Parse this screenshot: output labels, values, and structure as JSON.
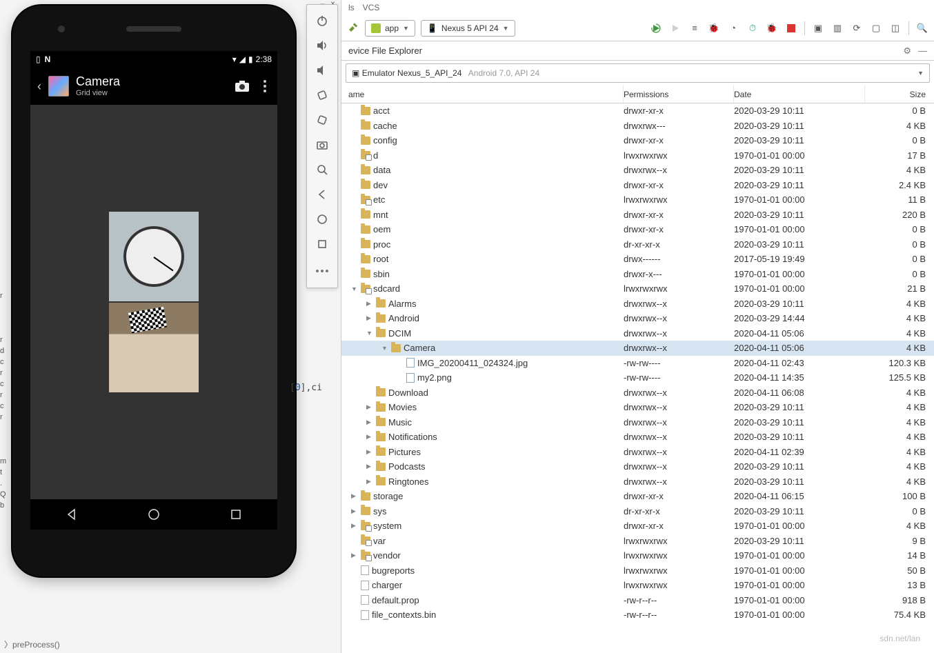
{
  "ide_menu_fragment": [
    "ls",
    "VCS"
  ],
  "emulator": {
    "status_time": "2:38",
    "app_title": "Camera",
    "app_subtitle": "Grid view"
  },
  "toolbar": {
    "run_config": "app",
    "device": "Nexus 5 API 24"
  },
  "panel": {
    "title": "evice File Explorer",
    "device_label": "Emulator Nexus_5_API_24",
    "device_sub": "Android 7.0, API 24"
  },
  "columns": {
    "name": "ame",
    "perm": "Permissions",
    "date": "Date",
    "size": "Size"
  },
  "tree": [
    {
      "d": 0,
      "t": "none",
      "ic": "folder",
      "n": "acct",
      "p": "drwxr-xr-x",
      "dt": "2020-03-29 10:11",
      "s": "0 B"
    },
    {
      "d": 0,
      "t": "none",
      "ic": "folder",
      "n": "cache",
      "p": "drwxrwx---",
      "dt": "2020-03-29 10:11",
      "s": "4 KB"
    },
    {
      "d": 0,
      "t": "none",
      "ic": "folder",
      "n": "config",
      "p": "drwxr-xr-x",
      "dt": "2020-03-29 10:11",
      "s": "0 B"
    },
    {
      "d": 0,
      "t": "none",
      "ic": "folderlink",
      "n": "d",
      "p": "lrwxrwxrwx",
      "dt": "1970-01-01 00:00",
      "s": "17 B"
    },
    {
      "d": 0,
      "t": "none",
      "ic": "folder",
      "n": "data",
      "p": "drwxrwx--x",
      "dt": "2020-03-29 10:11",
      "s": "4 KB"
    },
    {
      "d": 0,
      "t": "none",
      "ic": "folder",
      "n": "dev",
      "p": "drwxr-xr-x",
      "dt": "2020-03-29 10:11",
      "s": "2.4 KB"
    },
    {
      "d": 0,
      "t": "none",
      "ic": "folderlink",
      "n": "etc",
      "p": "lrwxrwxrwx",
      "dt": "1970-01-01 00:00",
      "s": "11 B"
    },
    {
      "d": 0,
      "t": "none",
      "ic": "folder",
      "n": "mnt",
      "p": "drwxr-xr-x",
      "dt": "2020-03-29 10:11",
      "s": "220 B"
    },
    {
      "d": 0,
      "t": "none",
      "ic": "folder",
      "n": "oem",
      "p": "drwxr-xr-x",
      "dt": "1970-01-01 00:00",
      "s": "0 B"
    },
    {
      "d": 0,
      "t": "none",
      "ic": "folder",
      "n": "proc",
      "p": "dr-xr-xr-x",
      "dt": "2020-03-29 10:11",
      "s": "0 B"
    },
    {
      "d": 0,
      "t": "none",
      "ic": "folder",
      "n": "root",
      "p": "drwx------",
      "dt": "2017-05-19 19:49",
      "s": "0 B"
    },
    {
      "d": 0,
      "t": "none",
      "ic": "folder",
      "n": "sbin",
      "p": "drwxr-x---",
      "dt": "1970-01-01 00:00",
      "s": "0 B"
    },
    {
      "d": 0,
      "t": "open",
      "ic": "folderlink",
      "n": "sdcard",
      "p": "lrwxrwxrwx",
      "dt": "1970-01-01 00:00",
      "s": "21 B"
    },
    {
      "d": 1,
      "t": "closed",
      "ic": "folder",
      "n": "Alarms",
      "p": "drwxrwx--x",
      "dt": "2020-03-29 10:11",
      "s": "4 KB"
    },
    {
      "d": 1,
      "t": "closed",
      "ic": "folder",
      "n": "Android",
      "p": "drwxrwx--x",
      "dt": "2020-03-29 14:44",
      "s": "4 KB"
    },
    {
      "d": 1,
      "t": "open",
      "ic": "folder",
      "n": "DCIM",
      "p": "drwxrwx--x",
      "dt": "2020-04-11 05:06",
      "s": "4 KB"
    },
    {
      "d": 2,
      "t": "open",
      "ic": "folder",
      "n": "Camera",
      "p": "drwxrwx--x",
      "dt": "2020-04-11 05:06",
      "s": "4 KB",
      "sel": true
    },
    {
      "d": 3,
      "t": "none",
      "ic": "file",
      "n": "IMG_20200411_024324.jpg",
      "p": "-rw-rw----",
      "dt": "2020-04-11 02:43",
      "s": "120.3 KB"
    },
    {
      "d": 3,
      "t": "none",
      "ic": "file",
      "n": "my2.png",
      "p": "-rw-rw----",
      "dt": "2020-04-11 14:35",
      "s": "125.5 KB"
    },
    {
      "d": 1,
      "t": "none",
      "ic": "folder",
      "n": "Download",
      "p": "drwxrwx--x",
      "dt": "2020-04-11 06:08",
      "s": "4 KB"
    },
    {
      "d": 1,
      "t": "closed",
      "ic": "folder",
      "n": "Movies",
      "p": "drwxrwx--x",
      "dt": "2020-03-29 10:11",
      "s": "4 KB"
    },
    {
      "d": 1,
      "t": "closed",
      "ic": "folder",
      "n": "Music",
      "p": "drwxrwx--x",
      "dt": "2020-03-29 10:11",
      "s": "4 KB"
    },
    {
      "d": 1,
      "t": "closed",
      "ic": "folder",
      "n": "Notifications",
      "p": "drwxrwx--x",
      "dt": "2020-03-29 10:11",
      "s": "4 KB"
    },
    {
      "d": 1,
      "t": "closed",
      "ic": "folder",
      "n": "Pictures",
      "p": "drwxrwx--x",
      "dt": "2020-04-11 02:39",
      "s": "4 KB"
    },
    {
      "d": 1,
      "t": "closed",
      "ic": "folder",
      "n": "Podcasts",
      "p": "drwxrwx--x",
      "dt": "2020-03-29 10:11",
      "s": "4 KB"
    },
    {
      "d": 1,
      "t": "closed",
      "ic": "folder",
      "n": "Ringtones",
      "p": "drwxrwx--x",
      "dt": "2020-03-29 10:11",
      "s": "4 KB"
    },
    {
      "d": 0,
      "t": "closed",
      "ic": "folder",
      "n": "storage",
      "p": "drwxr-xr-x",
      "dt": "2020-04-11 06:15",
      "s": "100 B"
    },
    {
      "d": 0,
      "t": "closed",
      "ic": "folder",
      "n": "sys",
      "p": "dr-xr-xr-x",
      "dt": "2020-03-29 10:11",
      "s": "0 B"
    },
    {
      "d": 0,
      "t": "closed",
      "ic": "folderlink",
      "n": "system",
      "p": "drwxr-xr-x",
      "dt": "1970-01-01 00:00",
      "s": "4 KB"
    },
    {
      "d": 0,
      "t": "none",
      "ic": "folderlink",
      "n": "var",
      "p": "lrwxrwxrwx",
      "dt": "2020-03-29 10:11",
      "s": "9 B"
    },
    {
      "d": 0,
      "t": "closed",
      "ic": "folderlink",
      "n": "vendor",
      "p": "lrwxrwxrwx",
      "dt": "1970-01-01 00:00",
      "s": "14 B"
    },
    {
      "d": 0,
      "t": "none",
      "ic": "fileunk",
      "n": "bugreports",
      "p": "lrwxrwxrwx",
      "dt": "1970-01-01 00:00",
      "s": "50 B"
    },
    {
      "d": 0,
      "t": "none",
      "ic": "fileunk",
      "n": "charger",
      "p": "lrwxrwxrwx",
      "dt": "1970-01-01 00:00",
      "s": "13 B"
    },
    {
      "d": 0,
      "t": "none",
      "ic": "fileunk",
      "n": "default.prop",
      "p": "-rw-r--r--",
      "dt": "1970-01-01 00:00",
      "s": "918 B"
    },
    {
      "d": 0,
      "t": "none",
      "ic": "fileunk",
      "n": "file_contexts.bin",
      "p": "-rw-r--r--",
      "dt": "1970-01-01 00:00",
      "s": "75.4 KB"
    }
  ],
  "code_fragment_a": "[",
  "code_fragment_num": "0",
  "code_fragment_b": "],ci",
  "breadcrumb": "preProcess()",
  "left_gutter": [
    "r",
    "",
    "",
    "",
    "r",
    "d",
    "c",
    "r",
    "c",
    "r",
    "c",
    "r",
    "",
    "",
    "",
    "m",
    "t",
    ".",
    "Q",
    "b"
  ]
}
